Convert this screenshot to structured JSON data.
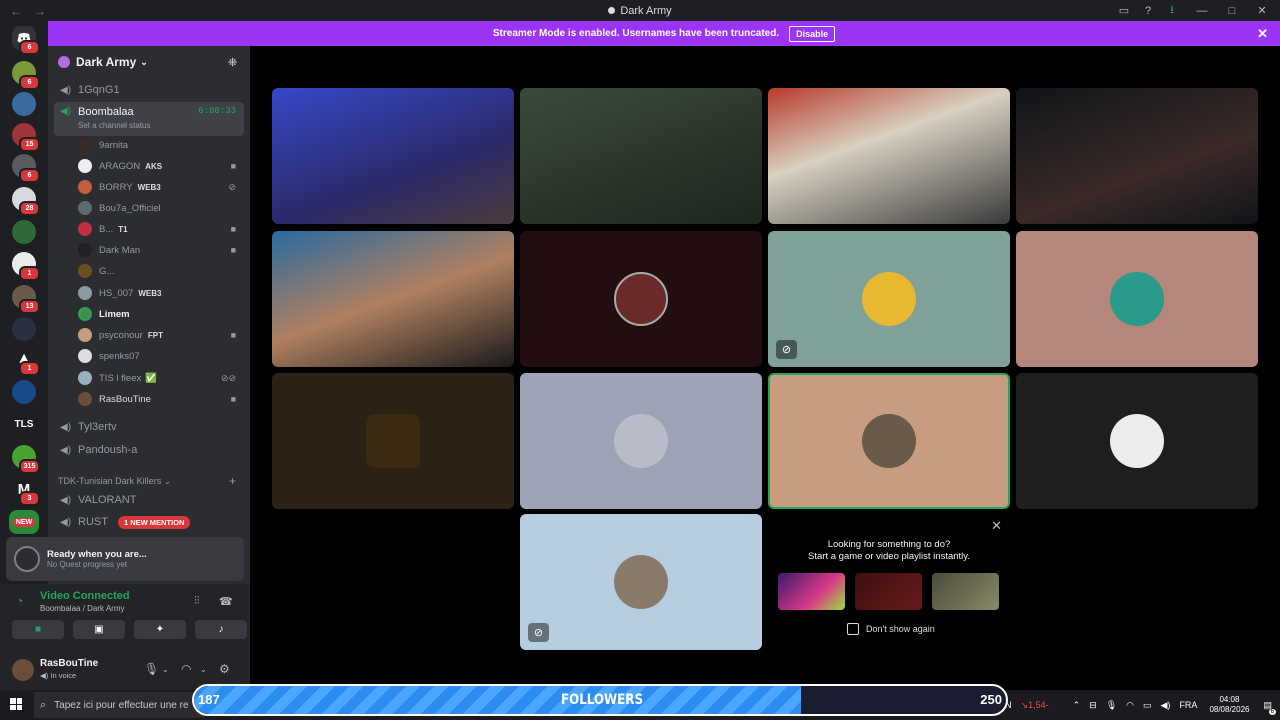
{
  "window": {
    "title": "Dark Army"
  },
  "banner": {
    "text": "Streamer Mode is enabled. Usernames have been truncated.",
    "button": "Disable"
  },
  "guilds": [
    {
      "badge": "6"
    },
    {
      "badge": "6"
    },
    {
      "badge": ""
    },
    {
      "badge": "15"
    },
    {
      "badge": "6"
    },
    {
      "badge": "28"
    },
    {
      "badge": ""
    },
    {
      "badge": "1"
    },
    {
      "badge": "13"
    },
    {
      "badge": ""
    },
    {
      "badge": "1"
    },
    {
      "badge": ""
    },
    {
      "label": "TLS",
      "badge": ""
    },
    {
      "badge": "315"
    },
    {
      "badge": "3"
    },
    {
      "label": "NEW",
      "badge": ""
    }
  ],
  "server": {
    "name": "Dark Army"
  },
  "channels": {
    "c1": "1GqnG1",
    "active": {
      "name": "Boombalaa",
      "timer": "6:00:33",
      "status": "Set a channel status"
    },
    "c3": "Tyl3ertv",
    "c4": "Pandoush-a",
    "category": "TDK-Tunisian Dark Killers",
    "c5": "VALORANT",
    "c6": "RUST",
    "mention": "1 NEW MENTION"
  },
  "users": [
    {
      "name": "9arnita",
      "tag": ""
    },
    {
      "name": "ARAGON",
      "tag": "AKS"
    },
    {
      "name": "BORRY",
      "tag": "WEB3"
    },
    {
      "name": "Bou7a_Officiel",
      "tag": ""
    },
    {
      "name": "B...",
      "tag": "T1"
    },
    {
      "name": "Dark Man",
      "tag": ""
    },
    {
      "name": "G...",
      "tag": ""
    },
    {
      "name": "HS_007",
      "tag": "WEB3"
    },
    {
      "name": "Limem",
      "tag": ""
    },
    {
      "name": "psyconour",
      "tag": "FPT"
    },
    {
      "name": "spenks07",
      "tag": ""
    },
    {
      "name": "TIS l fleex",
      "tag": ""
    },
    {
      "name": "RasBouTine",
      "tag": ""
    }
  ],
  "quest": {
    "title": "Ready when you are...",
    "subtitle": "No Quest progress yet"
  },
  "voice": {
    "title": "Video Connected",
    "subtitle": "Boombalaa / Dark Army"
  },
  "me": {
    "name": "RasBouTine",
    "status": "In voice"
  },
  "suggest": {
    "line1": "Looking for something to do?",
    "line2": "Start a game or video playlist instantly.",
    "checkbox": "Don't show again"
  },
  "taskbar": {
    "search": "Tapez ici pour effectuer une re",
    "tray_ticker": "ALCN",
    "tray_value": "↘1,54-",
    "lang": "FRA",
    "time": "04:08",
    "date": "08/08/2026",
    "notif": "6"
  },
  "followers": {
    "label": "FOLLOWERS",
    "current": "187",
    "goal": "250",
    "progress": 0.748
  }
}
